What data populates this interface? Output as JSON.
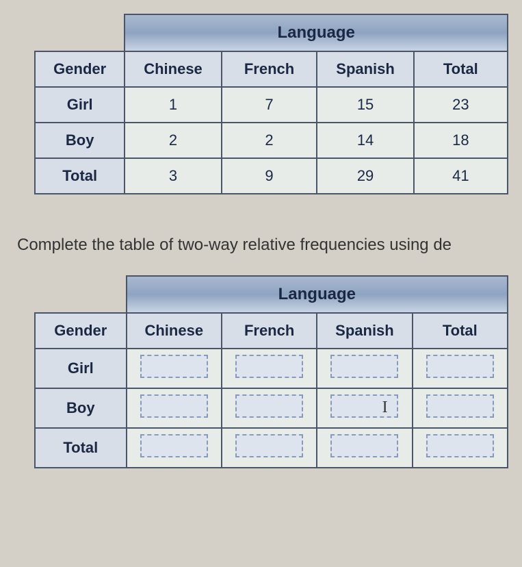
{
  "table1": {
    "langHeader": "Language",
    "genderHeader": "Gender",
    "columns": [
      "Chinese",
      "French",
      "Spanish",
      "Total"
    ],
    "rows": [
      {
        "label": "Girl",
        "values": [
          "1",
          "7",
          "15",
          "23"
        ]
      },
      {
        "label": "Boy",
        "values": [
          "2",
          "2",
          "14",
          "18"
        ]
      },
      {
        "label": "Total",
        "values": [
          "3",
          "9",
          "29",
          "41"
        ]
      }
    ]
  },
  "instruction": "Complete the table of two-way relative frequencies using de",
  "table2": {
    "langHeader": "Language",
    "genderHeader": "Gender",
    "columns": [
      "Chinese",
      "French",
      "Spanish",
      "Total"
    ],
    "rows": [
      {
        "label": "Girl"
      },
      {
        "label": "Boy"
      },
      {
        "label": "Total"
      }
    ]
  },
  "chart_data": {
    "type": "table",
    "title": "Two-way frequency table: Gender vs Language",
    "columns": [
      "Gender",
      "Chinese",
      "French",
      "Spanish",
      "Total"
    ],
    "rows": [
      [
        "Girl",
        1,
        7,
        15,
        23
      ],
      [
        "Boy",
        2,
        2,
        14,
        18
      ],
      [
        "Total",
        3,
        9,
        29,
        41
      ]
    ]
  }
}
